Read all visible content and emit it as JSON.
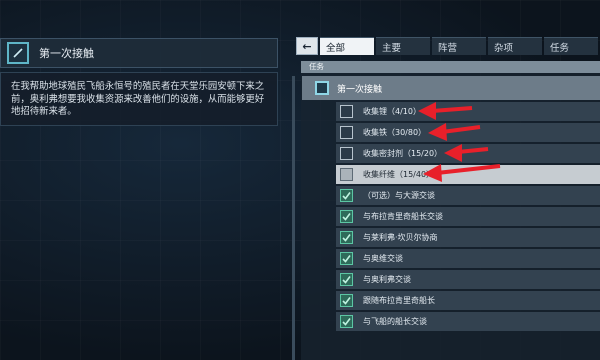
{
  "quest": {
    "title": "第一次接触",
    "description": "在我帮助地球殖民飞船永恒号的殖民者在天堂乐园安顿下来之前，奥利弗想要我收集资源来改善他们的设施，从而能够更好地招待新来者。",
    "icon": "quest-icon"
  },
  "tabs": {
    "back_icon": "←",
    "items": [
      {
        "label": "全部",
        "active": true
      },
      {
        "label": "主要",
        "active": false
      },
      {
        "label": "阵营",
        "active": false
      },
      {
        "label": "杂项",
        "active": false
      },
      {
        "label": "任务",
        "active": false
      }
    ]
  },
  "list": {
    "section_label": "任务",
    "category_label": "第一次接触",
    "objectives": [
      {
        "label": "收集锂（4/10）",
        "checked": false,
        "highlighted": false
      },
      {
        "label": "收集铁（30/80）",
        "checked": false,
        "highlighted": false
      },
      {
        "label": "收集密封剂（15/20）",
        "checked": false,
        "highlighted": false
      },
      {
        "label": "收集纤维（15/40）",
        "checked": false,
        "highlighted": true
      },
      {
        "label": "（可选）与大源交谈",
        "checked": true,
        "highlighted": false
      },
      {
        "label": "与布拉肯里奇船长交谈",
        "checked": true,
        "highlighted": false
      },
      {
        "label": "与莱利弗·坎贝尔协商",
        "checked": true,
        "highlighted": false
      },
      {
        "label": "与奥维交谈",
        "checked": true,
        "highlighted": false
      },
      {
        "label": "与奥利弗交谈",
        "checked": true,
        "highlighted": false
      },
      {
        "label": "跟随布拉肯里奇船长",
        "checked": true,
        "highlighted": false
      },
      {
        "label": "与飞船的船长交谈",
        "checked": true,
        "highlighted": false
      }
    ]
  },
  "colors": {
    "accent": "#5fb6c8",
    "check": "#5cc6a4",
    "annotation_arrow": "#e8202a"
  }
}
